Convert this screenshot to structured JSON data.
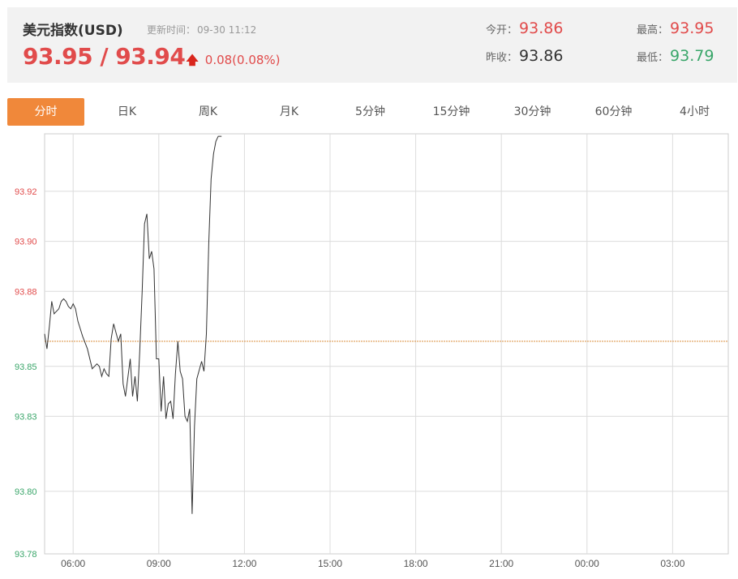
{
  "header": {
    "title": "美元指数(USD)",
    "update_label": "更新时间：",
    "update_time": "09-30 11:12",
    "price": "93.95 / 93.94",
    "change": "0.08(0.08%)",
    "open_label": "今开：",
    "open_value": "93.86",
    "prev_close_label": "昨收：",
    "prev_close_value": "93.86",
    "high_label": "最高：",
    "high_value": "93.95",
    "low_label": "最低：",
    "low_value": "93.79"
  },
  "tabs": [
    "分时",
    "日K",
    "周K",
    "月K",
    "5分钟",
    "15分钟",
    "30分钟",
    "60分钟",
    "4小时"
  ],
  "active_tab": "分时",
  "colors": {
    "up": "#e14b4b",
    "down": "#3aa66a",
    "accent": "#f0883a",
    "ref_line": "#d98c3a"
  },
  "chart_data": {
    "type": "line",
    "reference_value": 93.86,
    "y_ticks": [
      "93.92",
      "93.90",
      "93.88",
      "93.85",
      "93.83",
      "93.80",
      "93.78"
    ],
    "x_ticks": [
      "06:00",
      "09:00",
      "12:00",
      "15:00",
      "18:00",
      "21:00",
      "00:00",
      "03:00"
    ],
    "x": [
      "05:00",
      "05:05",
      "05:10",
      "05:15",
      "05:20",
      "05:30",
      "05:35",
      "05:40",
      "05:45",
      "05:50",
      "05:55",
      "06:00",
      "06:05",
      "06:10",
      "06:15",
      "06:20",
      "06:30",
      "06:40",
      "06:50",
      "06:55",
      "07:00",
      "07:05",
      "07:10",
      "07:15",
      "07:20",
      "07:25",
      "07:35",
      "07:40",
      "07:45",
      "07:50",
      "08:00",
      "08:05",
      "08:10",
      "08:15",
      "08:20",
      "08:25",
      "08:30",
      "08:35",
      "08:40",
      "08:45",
      "08:50",
      "08:55",
      "09:00",
      "09:05",
      "09:10",
      "09:15",
      "09:20",
      "09:25",
      "09:30",
      "09:35",
      "09:40",
      "09:45",
      "09:50",
      "09:55",
      "10:00",
      "10:05",
      "10:10",
      "10:15",
      "10:20",
      "10:30",
      "10:35",
      "10:40",
      "10:45",
      "10:50",
      "10:55",
      "11:00",
      "11:05",
      "11:12"
    ],
    "values": [
      93.863,
      93.857,
      93.866,
      93.876,
      93.871,
      93.873,
      93.876,
      93.877,
      93.876,
      93.874,
      93.873,
      93.875,
      93.873,
      93.868,
      93.865,
      93.862,
      93.857,
      93.849,
      93.851,
      93.85,
      93.846,
      93.849,
      93.847,
      93.846,
      93.861,
      93.867,
      93.86,
      93.863,
      93.843,
      93.838,
      93.853,
      93.838,
      93.846,
      93.836,
      93.856,
      93.88,
      93.907,
      93.911,
      93.893,
      93.896,
      93.889,
      93.853,
      93.853,
      93.832,
      93.846,
      93.829,
      93.835,
      93.836,
      93.829,
      93.847,
      93.86,
      93.848,
      93.845,
      93.83,
      93.828,
      93.833,
      93.791,
      93.826,
      93.845,
      93.852,
      93.848,
      93.863,
      93.899,
      93.925,
      93.935,
      93.94,
      93.942,
      93.942
    ],
    "ylim": [
      93.775,
      93.943
    ]
  }
}
